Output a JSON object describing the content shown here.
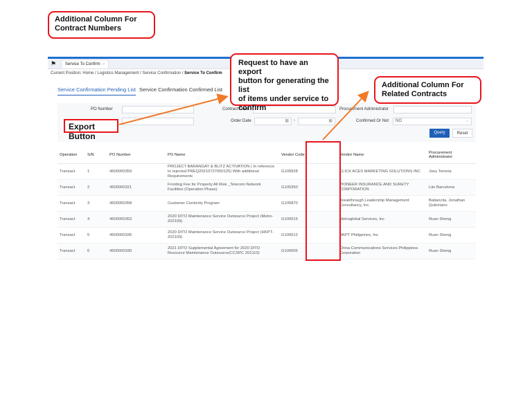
{
  "annotations": {
    "contract_numbers": [
      "Additional Column For",
      "Contract Numbers"
    ],
    "export_request": [
      "Request to have an export",
      "button for generating the list",
      "of items under service to",
      "confirm"
    ],
    "related_contracts": [
      "Additional Column For",
      "Related Contracts"
    ],
    "export_button": "Export Button",
    "accent_color": "#e8141b",
    "arrow_color": "#f07a2a"
  },
  "tabbar": {
    "home_icon": "home-icon",
    "active_tab": "Service To Confirm",
    "close_icon": "close-icon"
  },
  "breadcrumb": {
    "prefix": "Current Position:",
    "items": [
      "Home",
      "Logistics Management",
      "Service Confirmation"
    ],
    "current": "Service To Confirm",
    "separator": "/"
  },
  "subtabs": {
    "pending": "Service Confirmation Pending List",
    "confirmed": "Service Confirmation Confirmed List"
  },
  "filters": {
    "po_number_label": "PO Number",
    "contract_code_label": "Contract Code",
    "procurement_admin_label": "Procurement Administrator",
    "order_date_label": "Order Date",
    "order_date_sep": "-",
    "confirmed_label": "Confirmed Or Not",
    "confirmed_value": "NO",
    "query_label": "Query",
    "reset_label": "Reset"
  },
  "table": {
    "columns": [
      "Operation",
      "S/N",
      "PO Number",
      "PO Name",
      "Vendor Code",
      "Vendor Name",
      "Procurement Administrator"
    ],
    "rows": [
      {
        "op": "Transact",
        "sn": "1",
        "po": "4500000359",
        "name": "PROJECT BARANGAY & BLITZ ACTIVATION ( In reference to rejected PREQ20210727000125) With additional Requirements",
        "vcode": "G105828",
        "vname": "CLICK ACES MARKETING SOLUTIONS INC",
        "admin": "Joey Tenoria"
      },
      {
        "op": "Transact",
        "sn": "2",
        "po": "4500000321",
        "name": "Fronting Fee for Property All Risk _Telecom Network Facilities (Operation Phase)",
        "vcode": "G105350",
        "vname": "PIONEER INSURANCE AND SURETY CORPORATION",
        "admin": "Lito Barcelona"
      },
      {
        "op": "Transact",
        "sn": "3",
        "po": "4500000358",
        "name": "Customer Centricity Program",
        "vcode": "G105870",
        "vname": "Breakthrough Leadership Management Consultancy, Inc.",
        "admin": "Batiancila, Jonathan Quitoriano"
      },
      {
        "op": "Transact",
        "sn": "4",
        "po": "4500000353",
        "name": "2020 DITO Maintenance Service Outsource Project (Metro-202109)",
        "vcode": "G100015",
        "vname": "Metroglobal Services, Inc",
        "admin": "Ruan Sheng"
      },
      {
        "op": "Transact",
        "sn": "5",
        "po": "4500000336",
        "name": "2020 DITO Maintenance Service Outsource Project (HKPT-202109)",
        "vcode": "G100012",
        "vname": "HKPT Philippines, Inc.",
        "admin": "Ruan Sheng"
      },
      {
        "op": "Transact",
        "sn": "6",
        "po": "4500000330",
        "name": "2021 DITO Supplemental Agreement for 2020 DITO Resource Maintenance Outsource(CCSPC 202110)",
        "vcode": "G100005",
        "vname": "China Communications Services Philippines Corporation",
        "admin": "Ruan Sheng"
      }
    ]
  }
}
